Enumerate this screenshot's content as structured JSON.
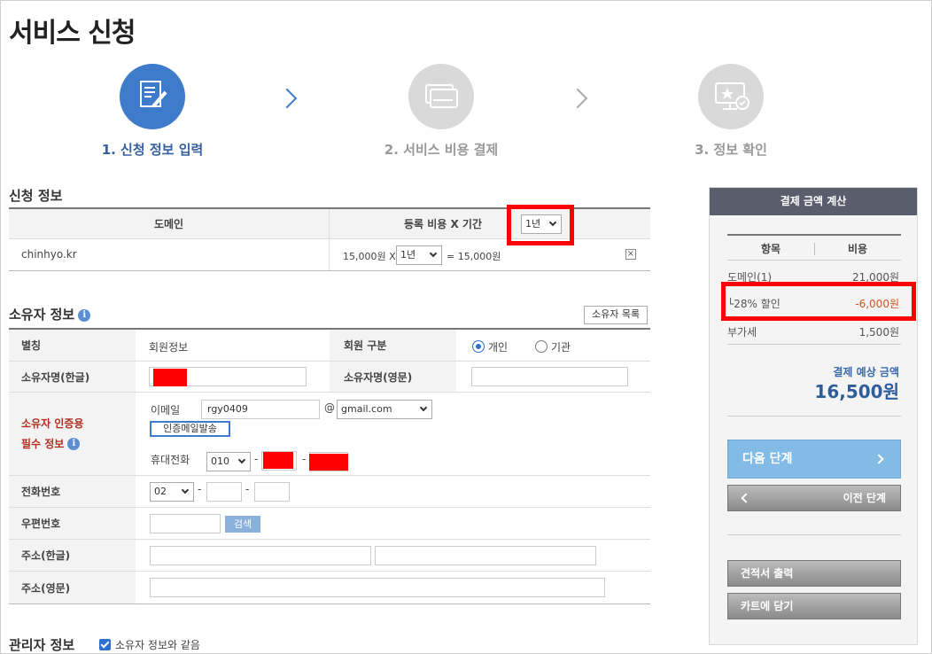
{
  "page_title": "서비스 신청",
  "steps": [
    {
      "label": "1. 신청 정보 입력",
      "active": true
    },
    {
      "label": "2. 서비스 비용 결제",
      "active": false
    },
    {
      "label": "3. 정보 확인",
      "active": false
    }
  ],
  "application": {
    "section_title": "신청 정보",
    "col_domain": "도메인",
    "col_cost": "등록 비용 X 기간",
    "period_header_select": "1년",
    "row": {
      "domain": "chinhyo.kr",
      "price": "15,000원 X",
      "period": "1년",
      "total": "= 15,000원",
      "remove": "×"
    }
  },
  "owner": {
    "section_title": "소유자 정보",
    "list_button": "소유자 목록",
    "alias_label": "별칭",
    "alias_value": "회원정보",
    "member_type_label": "회원 구분",
    "member_type_options": [
      "개인",
      "기관"
    ],
    "member_type_selected": "개인",
    "name_kr_label": "소유자명(한글)",
    "name_en_label": "소유자명(영문)",
    "auth_label_line1": "소유자 인증용",
    "auth_label_line2": "필수 정보",
    "email_label": "이메일",
    "email_id": "rgy0409",
    "email_at": "@",
    "email_domain": "gmail.com",
    "send_auth_button": "인증메일발송",
    "mobile_label": "휴대전화",
    "mobile_prefix": "010",
    "dash": "-",
    "phone_label": "전화번호",
    "phone_prefix": "02",
    "zip_label": "우편번호",
    "search_button": "검색",
    "addr_kr_label": "주소(한글)",
    "addr_en_label": "주소(영문)"
  },
  "admin": {
    "section_title": "관리자 정보",
    "same_as_owner": "소유자 정보와 같음",
    "same_checked": true
  },
  "panel": {
    "title": "결제 금액 계산",
    "col_item": "항목",
    "col_cost": "비용",
    "rows": [
      {
        "item": "도메인(1)",
        "cost": "21,000원"
      },
      {
        "item": "└28% 할인",
        "cost": "-6,000원"
      },
      {
        "item": "부가세",
        "cost": "1,500원"
      }
    ],
    "expected_label": "결제 예상 금액",
    "expected_value": "16,500원",
    "next_button": "다음 단계",
    "prev_button": "이전 단계",
    "quote_button": "견적서 출력",
    "cart_button": "카트에 담기"
  },
  "colors": {
    "accent": "#3e7ccb",
    "highlight": "#ff0000",
    "discount": "#d2541f"
  }
}
